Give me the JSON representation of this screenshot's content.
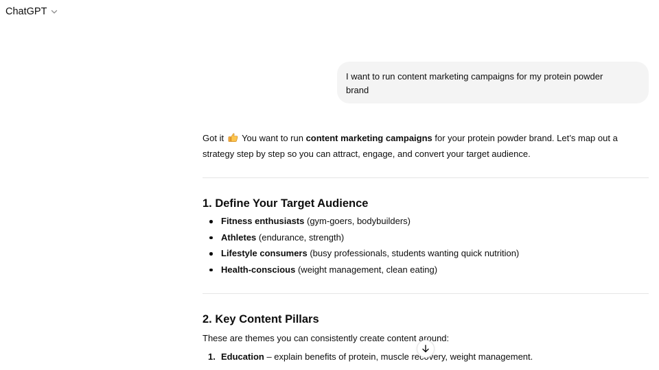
{
  "header": {
    "model_name": "ChatGPT",
    "model_chevron_icon": "chevron-down-icon"
  },
  "conversation": {
    "user_message": "I want to run content marketing campaigns for my protein powder brand",
    "assistant": {
      "intro": {
        "part1": "Got it",
        "emoji_icon": "thumbs-up-icon",
        "part2": " You want to run ",
        "bold": "content marketing campaigns",
        "part3": " for your protein powder brand. Let’s map out a strategy step by step so you can attract, engage, and convert your target audience."
      },
      "section1": {
        "heading": "1. Define Your Target Audience",
        "items": [
          {
            "bold": "Fitness enthusiasts",
            "rest": " (gym-goers, bodybuilders)"
          },
          {
            "bold": "Athletes",
            "rest": " (endurance, strength)"
          },
          {
            "bold": "Lifestyle consumers",
            "rest": " (busy professionals, students wanting quick nutrition)"
          },
          {
            "bold": "Health-conscious",
            "rest": " (weight management, clean eating)"
          }
        ]
      },
      "section2": {
        "heading": "2. Key Content Pillars",
        "lead": "These are themes you can consistently create content around:",
        "items": [
          {
            "num": "1.",
            "bold": "Education",
            "rest": " – explain benefits of protein, muscle recovery, weight management."
          }
        ]
      }
    }
  },
  "scroll_down_button_icon": "arrow-down-icon",
  "colors": {
    "user_bubble_bg": "#f4f4f4",
    "divider": "#e5e5e5",
    "text": "#0d0d0d"
  }
}
